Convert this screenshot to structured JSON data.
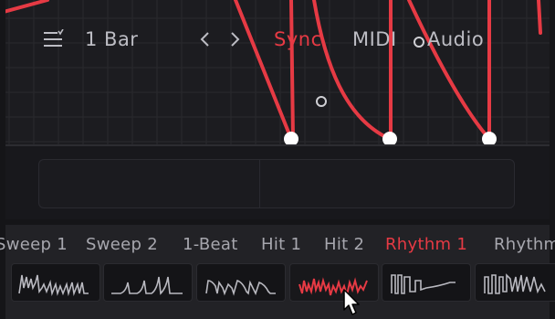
{
  "toolbar": {
    "length": "1 Bar",
    "modes": [
      {
        "label": "Sync",
        "active": true
      },
      {
        "label": "MIDI",
        "active": false
      },
      {
        "label": "Audio",
        "active": false
      }
    ]
  },
  "presets": {
    "items": [
      {
        "label": "Sweep 1",
        "active": false
      },
      {
        "label": "Sweep 2",
        "active": false
      },
      {
        "label": "1-Beat",
        "active": false
      },
      {
        "label": "Hit 1",
        "active": false
      },
      {
        "label": "Hit 2",
        "active": false
      },
      {
        "label": "Rhythm 1",
        "active": true
      },
      {
        "label": "Rhythm",
        "active": false
      }
    ]
  },
  "colors": {
    "accent": "#e63a44",
    "text": "#bdbdc4",
    "panel": "#18181c",
    "grid": "#2a2a2e"
  }
}
